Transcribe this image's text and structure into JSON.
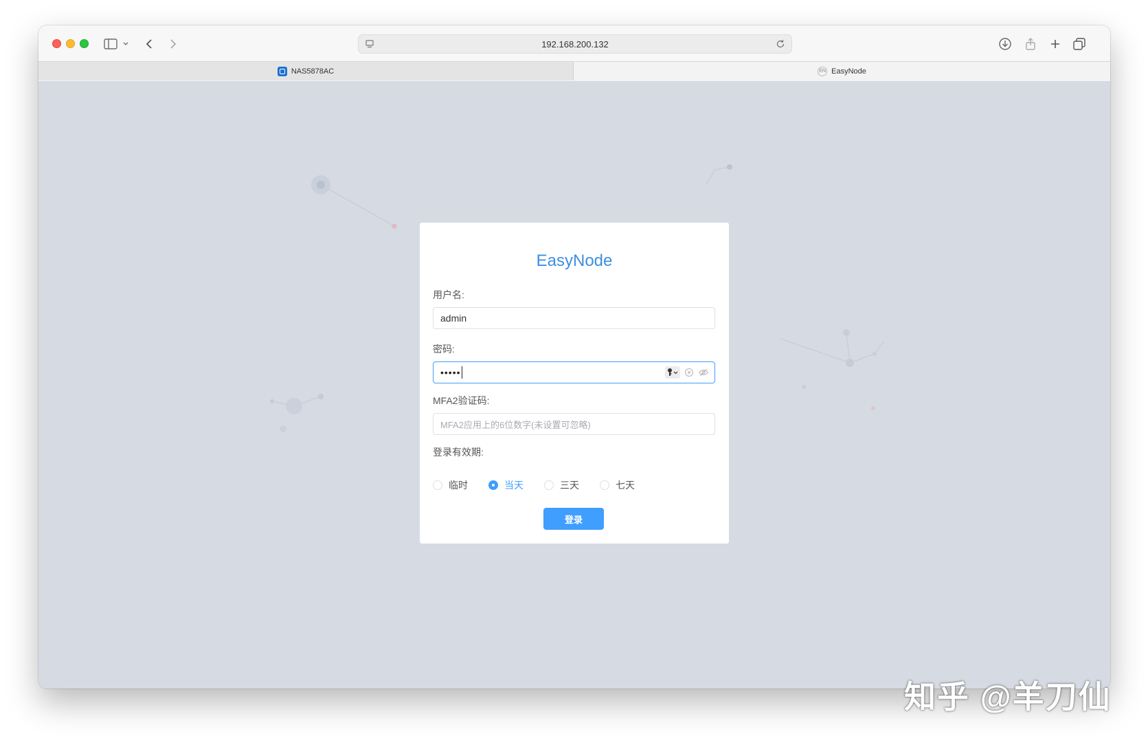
{
  "browser": {
    "url": "192.168.200.132",
    "tabs": [
      {
        "label": "NAS5878AC"
      },
      {
        "label": "EasyNode"
      }
    ]
  },
  "login": {
    "title": "EasyNode",
    "username_label": "用户名:",
    "username_value": "admin",
    "password_label": "密码:",
    "password_mask": "•••••",
    "mfa_label": "MFA2验证码:",
    "mfa_placeholder": "MFA2应用上的6位数字(未设置可忽略)",
    "duration_label": "登录有效期:",
    "duration_options": [
      {
        "label": "临时",
        "checked": false
      },
      {
        "label": "当天",
        "checked": true
      },
      {
        "label": "三天",
        "checked": false
      },
      {
        "label": "七天",
        "checked": false
      }
    ],
    "submit_label": "登录"
  },
  "watermark": "知乎 @羊刀仙",
  "colors": {
    "accent": "#409eff",
    "title": "#3d8fdf",
    "background": "#d5dae3"
  }
}
